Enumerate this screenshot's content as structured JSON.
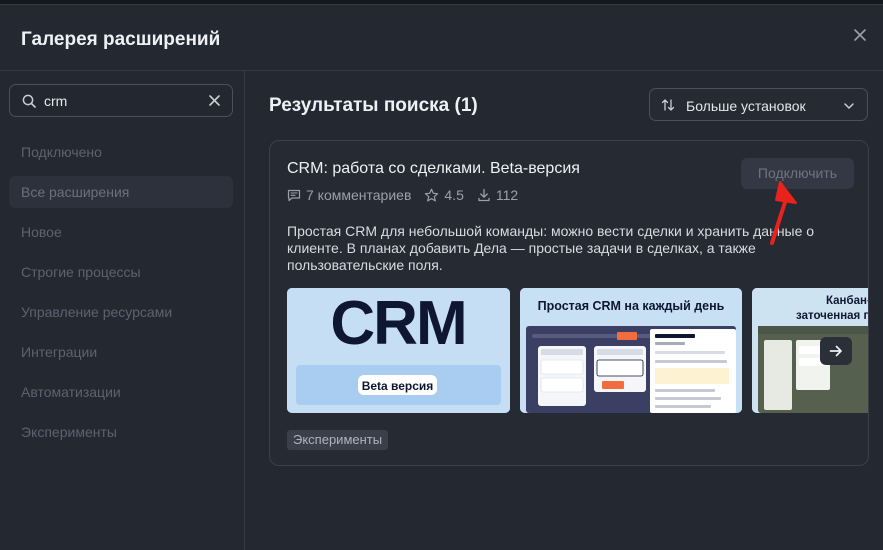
{
  "modal": {
    "title": "Галерея расширений"
  },
  "search": {
    "value": "crm"
  },
  "sidebar": {
    "items": [
      {
        "label": "Подключено",
        "active": false
      },
      {
        "label": "Все расширения",
        "active": true
      },
      {
        "label": "Новое",
        "active": false
      },
      {
        "label": "Строгие процессы",
        "active": false
      },
      {
        "label": "Управление ресурсами",
        "active": false
      },
      {
        "label": "Интеграции",
        "active": false
      },
      {
        "label": "Автоматизации",
        "active": false
      },
      {
        "label": "Эксперименты",
        "active": false
      }
    ]
  },
  "main": {
    "results_title": "Результаты поиска (1)",
    "sort_label": "Больше установок"
  },
  "card": {
    "title": "CRM: работа со сделками. Beta-версия",
    "connect_label": "Подключить",
    "comments": "7 комментариев",
    "rating": "4.5",
    "installs": "112",
    "description": "Простая CRM для небольшой команды: можно вести сделки и хранить данные о клиенте. В планах добавить Дела — простые задачи в сделках, а также пользовательские поля.",
    "tag": "Эксперименты",
    "screenshots": {
      "shot1_logo": "CRM",
      "shot1_badge": "Beta версия",
      "shot2_heading": "Простая CRM на каждый день",
      "shot3_heading_line1": "Канбан-",
      "shot3_heading_line2": "заточенная под"
    }
  },
  "colors": {
    "modal_bg": "#242831",
    "annotation_arrow": "#e8231c",
    "screenshot_bg": "#c5def4",
    "orange_label": "#f26d3d"
  }
}
